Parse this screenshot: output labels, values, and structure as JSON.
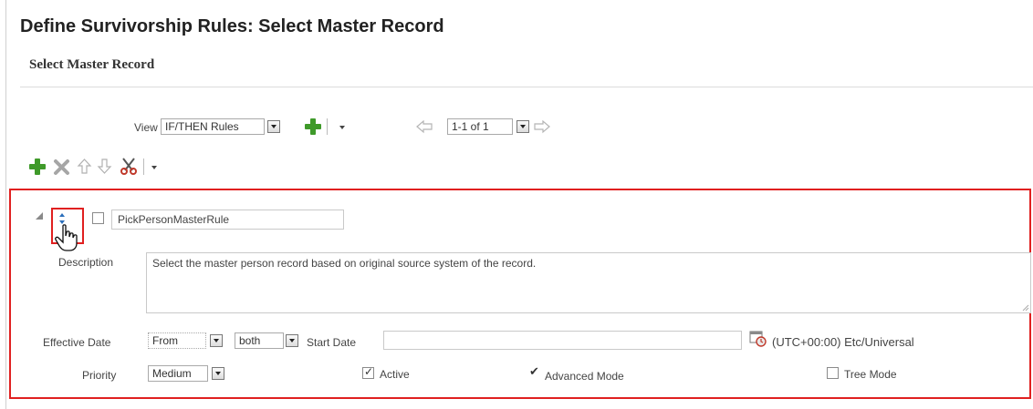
{
  "header": {
    "page_title": "Define Survivorship Rules: Select Master Record",
    "section_title": "Select Master Record"
  },
  "toolbar": {
    "view_label": "View",
    "view_value": "IF/THEN Rules",
    "pager_value": "1-1 of 1",
    "icons": [
      "add-icon",
      "delete-icon",
      "move-up-icon",
      "move-down-icon",
      "cut-icon"
    ]
  },
  "rule": {
    "name": "PickPersonMasterRule",
    "description_label": "Description",
    "description": "Select the master person record based on original source system of the record.",
    "effective_date_label": "Effective Date",
    "effective_from": "From",
    "effective_both": "both",
    "start_date_label": "Start Date",
    "start_date_value": "",
    "timezone": "(UTC+00:00) Etc/Universal",
    "priority_label": "Priority",
    "priority_value": "Medium",
    "active_label": "Active",
    "active_checked": true,
    "advanced_mode_label": "Advanced Mode",
    "advanced_mode_checked": true,
    "tree_mode_label": "Tree Mode",
    "tree_mode_checked": false
  },
  "colors": {
    "highlight_border": "#e02020",
    "add_green": "#3f9a2a",
    "delete_gray": "#9a9a9a",
    "cut_red": "#c0392b"
  }
}
